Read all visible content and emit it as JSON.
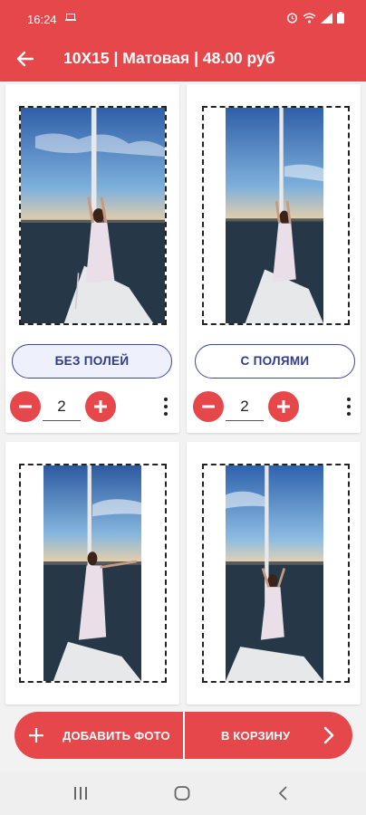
{
  "status_bar": {
    "time": "16:24",
    "icons": [
      "laptop-icon",
      "alarm-icon",
      "wifi-icon",
      "signal-icon",
      "battery-icon"
    ]
  },
  "app_bar": {
    "title": "10X15 | Матовая | 48.00 руб",
    "back_icon": "arrow-left-icon"
  },
  "photos": [
    {
      "mode_label": "БЕЗ ПОЛЕЙ",
      "mode_active": true,
      "quantity": "2"
    },
    {
      "mode_label": "С ПОЛЯМИ",
      "mode_active": false,
      "quantity": "2"
    },
    {},
    {}
  ],
  "actions": {
    "add_photo_label": "ДОБАВИТЬ ФОТО",
    "to_cart_label": "В КОРЗИНУ"
  },
  "colors": {
    "brand_red": "#e6474b",
    "button_blue": "#2f3b8a"
  }
}
